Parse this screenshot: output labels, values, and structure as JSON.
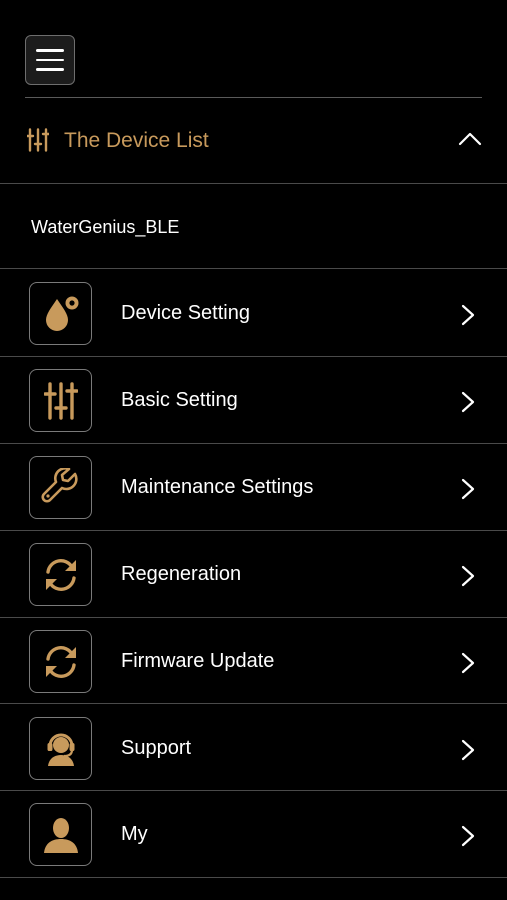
{
  "header": {
    "menu_icon": "hamburger-menu-icon"
  },
  "section": {
    "title": "The Device List",
    "icon": "sliders-icon",
    "toggle_icon": "chevron-up-icon",
    "accent_color": "#c89a5c"
  },
  "device": {
    "name": "WaterGenius_BLE"
  },
  "menu": {
    "items": [
      {
        "label": "Device Setting",
        "icon": "water-drop-settings-icon"
      },
      {
        "label": "Basic Setting",
        "icon": "sliders-icon"
      },
      {
        "label": "Maintenance Settings",
        "icon": "wrench-icon"
      },
      {
        "label": "Regeneration",
        "icon": "refresh-icon"
      },
      {
        "label": "Firmware Update",
        "icon": "refresh-icon"
      },
      {
        "label": "Support",
        "icon": "headset-support-icon"
      },
      {
        "label": "My",
        "icon": "user-profile-icon"
      }
    ]
  }
}
